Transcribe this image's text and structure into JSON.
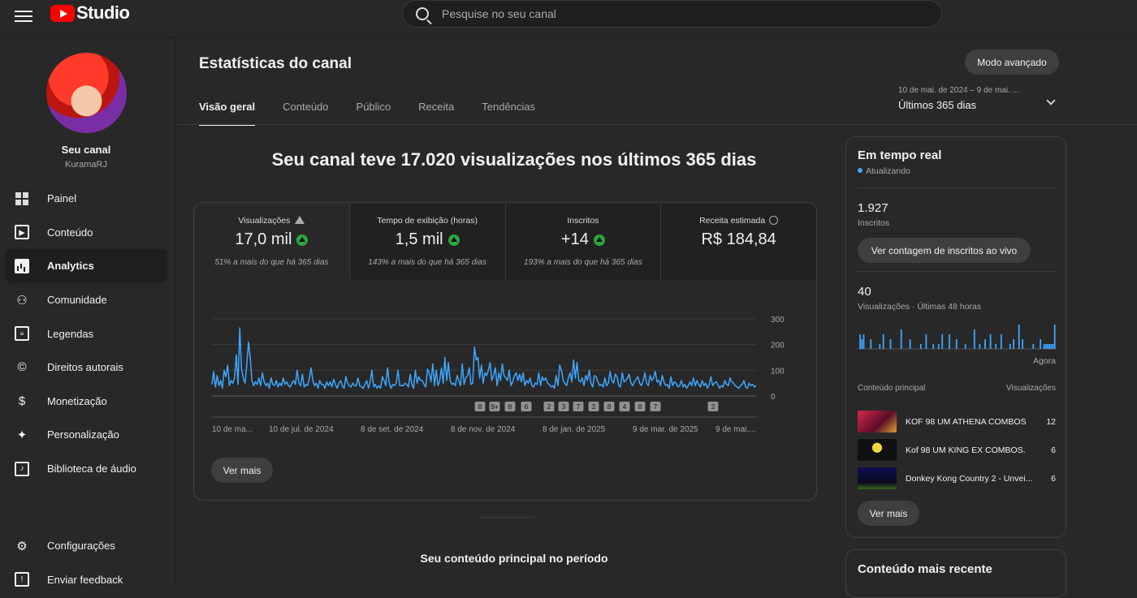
{
  "header": {
    "logo_text": "Studio",
    "search_placeholder": "Pesquise no seu canal"
  },
  "sidebar": {
    "channel_name": "Seu canal",
    "channel_handle": "KuramaRJ",
    "items": [
      {
        "label": "Painel",
        "icon": "dashboard-icon"
      },
      {
        "label": "Conteúdo",
        "icon": "content-icon"
      },
      {
        "label": "Analytics",
        "icon": "analytics-icon"
      },
      {
        "label": "Comunidade",
        "icon": "community-icon"
      },
      {
        "label": "Legendas",
        "icon": "subtitles-icon"
      },
      {
        "label": "Direitos autorais",
        "icon": "copyright-icon"
      },
      {
        "label": "Monetização",
        "icon": "monetization-icon"
      },
      {
        "label": "Personalização",
        "icon": "customization-icon"
      },
      {
        "label": "Biblioteca de áudio",
        "icon": "audio-library-icon"
      }
    ],
    "active_item": "Analytics",
    "bottom": [
      {
        "label": "Configurações",
        "icon": "settings-icon"
      },
      {
        "label": "Enviar feedback",
        "icon": "feedback-icon"
      }
    ]
  },
  "main": {
    "title": "Estatísticas do canal",
    "advanced_button": "Modo avançado",
    "tabs": [
      "Visão geral",
      "Conteúdo",
      "Público",
      "Receita",
      "Tendências"
    ],
    "active_tab": "Visão geral",
    "date_range": {
      "sub": "10 de mai. de 2024 – 9 de mai. ...",
      "value": "Últimos 365 dias"
    },
    "headline": "Seu canal teve 17.020 visualizações nos últimos 365 dias",
    "metrics": [
      {
        "label": "Visualizações",
        "value": "17,0 mil",
        "trend": "up",
        "compare": "51% a mais do que há 365 dias"
      },
      {
        "label": "Tempo de exibição (horas)",
        "value": "1,5 mil",
        "trend": "up",
        "compare": "143% a mais do que há 365 dias"
      },
      {
        "label": "Inscritos",
        "value": "+14",
        "trend": "up",
        "compare": "193% a mais do que há 365 dias"
      },
      {
        "label": "Receita estimada",
        "value": "R$ 184,84",
        "trend": "",
        "compare": ""
      }
    ],
    "see_more": "Ver mais",
    "section_title": "Seu conteúdo principal no período"
  },
  "chart_data": {
    "type": "line",
    "series": [
      {
        "values": [
          45,
          95,
          35,
          80,
          40,
          60,
          30,
          100,
          75,
          120,
          40,
          60,
          50,
          70,
          160,
          45,
          265,
          105,
          70,
          50,
          120,
          210,
          150,
          60,
          40,
          55,
          45,
          70,
          40,
          90,
          55,
          40,
          50,
          30,
          70,
          45,
          40,
          60,
          35,
          50,
          40,
          70,
          45,
          55,
          40,
          35,
          50,
          60,
          45,
          100,
          50,
          40,
          85,
          35,
          45,
          40,
          70,
          110,
          60,
          40,
          50,
          30,
          60,
          45,
          45,
          30,
          55,
          40,
          55,
          35,
          65,
          45,
          30,
          50,
          60,
          40,
          30,
          75,
          50,
          40,
          35,
          50,
          40,
          40,
          70,
          40,
          35,
          30,
          45,
          60,
          30,
          55,
          100,
          35,
          45,
          30,
          40,
          30,
          75,
          60,
          40,
          110,
          50,
          30,
          45,
          40,
          50,
          100,
          40,
          40,
          40,
          50,
          45,
          35,
          85,
          45,
          30,
          100,
          50,
          75,
          60,
          60,
          45,
          35,
          105,
          90,
          55,
          125,
          40,
          100,
          40,
          60,
          110,
          50,
          150,
          60,
          130,
          60,
          45,
          50,
          40,
          80,
          60,
          40,
          125,
          45,
          70,
          80,
          110,
          45,
          50,
          190,
          140,
          150,
          70,
          120,
          50,
          90,
          80,
          100,
          130,
          60,
          80,
          110,
          40,
          90,
          60,
          125,
          80,
          70,
          60,
          100,
          40,
          55,
          80,
          90,
          60,
          85,
          55,
          90,
          40,
          60,
          50,
          70,
          40,
          35,
          50,
          45,
          90,
          40,
          75,
          60,
          70,
          50,
          45,
          35,
          40,
          30,
          80,
          40,
          120,
          100,
          60,
          50,
          40,
          70,
          90,
          55,
          140,
          70,
          130,
          60,
          55,
          70,
          40,
          80,
          60,
          100,
          50,
          35,
          80,
          75,
          55,
          40,
          45,
          35,
          70,
          40,
          50,
          95,
          60,
          50,
          85,
          75,
          40,
          35,
          90,
          55,
          60,
          70,
          85,
          50,
          40,
          55,
          65,
          75,
          50,
          40,
          60,
          90,
          50,
          40,
          80,
          60,
          70,
          95,
          55,
          60,
          40,
          80,
          55,
          40,
          45,
          30,
          75,
          40,
          55,
          50,
          35,
          40,
          60,
          35,
          45,
          30,
          40,
          55,
          40,
          70,
          40,
          60,
          45,
          35,
          60,
          40,
          50,
          30,
          45,
          75,
          40,
          50,
          55,
          45,
          30,
          40,
          35,
          60,
          45,
          40,
          70,
          55,
          50,
          40,
          35,
          30,
          40,
          45,
          60,
          35,
          30,
          50,
          40,
          45,
          35,
          40
        ]
      }
    ],
    "x_tick_labels": [
      "10 de ma...",
      "10 de jul. de 2024",
      "8 de set. de 2024",
      "8 de nov. de 2024",
      "8 de jan. de 2025",
      "9 de mar. de 2025",
      "9 de mai...."
    ],
    "y_tick_labels": [
      "300",
      "200",
      "100",
      "0"
    ],
    "ylim": [
      0,
      300
    ],
    "markers": [
      "8",
      "9+",
      "8",
      "6",
      "2",
      "3",
      "7",
      "2",
      "8",
      "4",
      "8",
      "7",
      "2"
    ],
    "line_color": "#3ea6ff"
  },
  "realtime": {
    "title": "Em tempo real",
    "status": "Atualizando",
    "subscribers_value": "1.927",
    "subscribers_label": "Inscritos",
    "live_button": "Ver contagem de inscritos ao vivo",
    "views_value": "40",
    "views_label": "Visualizações · Últimas 48 horas",
    "now_label": "Agora",
    "bars": [
      0,
      3,
      2,
      3,
      0,
      0,
      0,
      2,
      0,
      0,
      0,
      0,
      1,
      0,
      3,
      0,
      0,
      0,
      2,
      0,
      0,
      0,
      0,
      0,
      4,
      0,
      0,
      0,
      0,
      2,
      0,
      0,
      0,
      0,
      0,
      1,
      0,
      0,
      3,
      0,
      0,
      0,
      1,
      0,
      0,
      1,
      0,
      3,
      0,
      0,
      0,
      3,
      0,
      0,
      0,
      2,
      0,
      0,
      0,
      0,
      1,
      0,
      0,
      0,
      0,
      4,
      0,
      0,
      1,
      0,
      0,
      2,
      0,
      0,
      3,
      0,
      0,
      1,
      0,
      0,
      3,
      0,
      0,
      0,
      0,
      1,
      0,
      2,
      0,
      0,
      5,
      0,
      2,
      0,
      0,
      0,
      0,
      0,
      1,
      0,
      0,
      0,
      2,
      0,
      1,
      1,
      1,
      1,
      1,
      1,
      5
    ],
    "list_header_left": "Conteúdo principal",
    "list_header_right": "Visualizações",
    "items": [
      {
        "title": "KOF 98 UM ATHENA COMBOS",
        "views": "12",
        "thumb": "#a8183c"
      },
      {
        "title": "Kof 98 UM KING EX COMBOS.",
        "views": "6",
        "thumb": "#111111"
      },
      {
        "title": "Donkey Kong Country 2 - Unvei...",
        "views": "6",
        "thumb": "#101040"
      }
    ],
    "see_more": "Ver mais"
  },
  "recent": {
    "title": "Conteúdo mais recente"
  }
}
